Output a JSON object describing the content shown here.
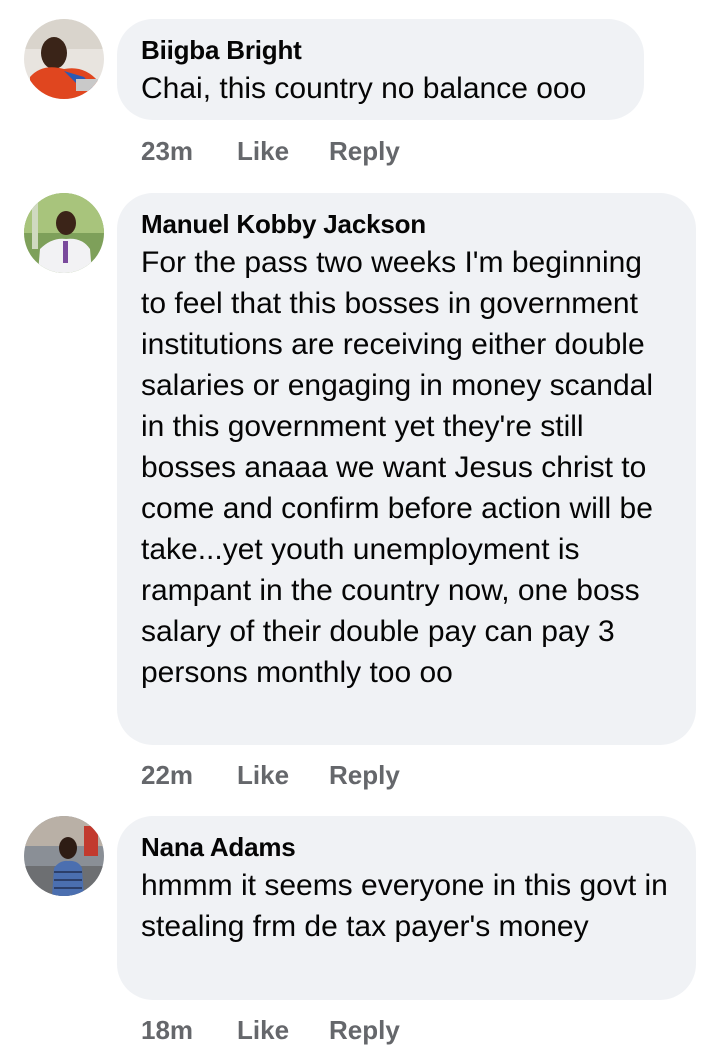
{
  "comments": [
    {
      "author": "Biigba Bright",
      "text": "Chai, this country no balance ooo",
      "time": "23m",
      "like_label": "Like",
      "reply_label": "Reply"
    },
    {
      "author": "Manuel Kobby Jackson",
      "text": "For the pass two weeks I'm beginning to feel that this bosses in government institutions are receiving either double salaries or engaging in money scandal in this government yet they're still bosses anaaa we want Jesus christ to come and confirm before action will be take...yet youth unemployment is rampant in the country now, one boss salary of their double pay can pay 3 persons monthly too oo",
      "time": "22m",
      "like_label": "Like",
      "reply_label": "Reply"
    },
    {
      "author": "Nana Adams",
      "text": "hmmm it seems everyone in this govt in stealing frm de tax payer's money",
      "time": "18m",
      "like_label": "Like",
      "reply_label": "Reply"
    }
  ],
  "colors": {
    "bubble": "#f0f2f5",
    "meta_text": "#65676b",
    "body_text": "#050505"
  }
}
